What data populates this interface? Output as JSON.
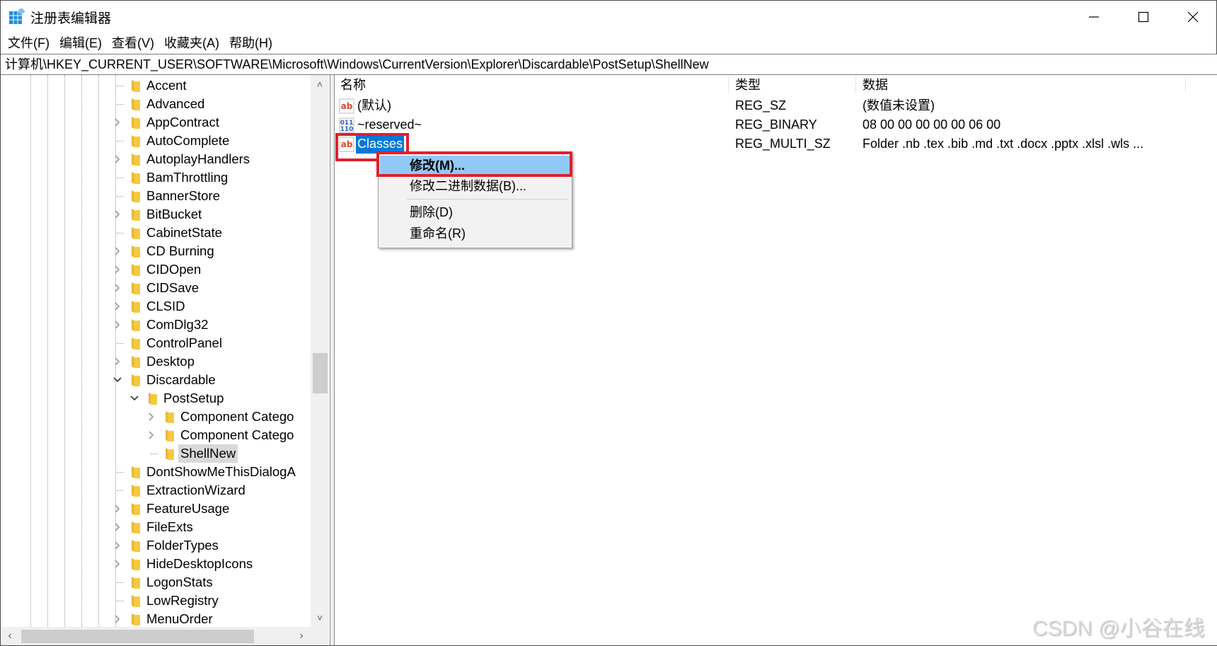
{
  "window": {
    "title": "注册表编辑器",
    "app_icon": "regedit-icon",
    "controls": {
      "minimize": "minimize-icon",
      "maximize": "maximize-icon",
      "close": "close-icon"
    }
  },
  "menu": [
    {
      "label": "文件(F)"
    },
    {
      "label": "编辑(E)"
    },
    {
      "label": "查看(V)"
    },
    {
      "label": "收藏夹(A)"
    },
    {
      "label": "帮助(H)"
    }
  ],
  "address": {
    "path": "计算机\\HKEY_CURRENT_USER\\SOFTWARE\\Microsoft\\Windows\\CurrentVersion\\Explorer\\Discardable\\PostSetup\\ShellNew"
  },
  "tree": {
    "items": [
      {
        "label": "Accent",
        "depth": 0,
        "expander": "none"
      },
      {
        "label": "Advanced",
        "depth": 0,
        "expander": "none"
      },
      {
        "label": "AppContract",
        "depth": 0,
        "expander": "collapsed"
      },
      {
        "label": "AutoComplete",
        "depth": 0,
        "expander": "none"
      },
      {
        "label": "AutoplayHandlers",
        "depth": 0,
        "expander": "collapsed"
      },
      {
        "label": "BamThrottling",
        "depth": 0,
        "expander": "none"
      },
      {
        "label": "BannerStore",
        "depth": 0,
        "expander": "none"
      },
      {
        "label": "BitBucket",
        "depth": 0,
        "expander": "collapsed"
      },
      {
        "label": "CabinetState",
        "depth": 0,
        "expander": "none"
      },
      {
        "label": "CD Burning",
        "depth": 0,
        "expander": "collapsed"
      },
      {
        "label": "CIDOpen",
        "depth": 0,
        "expander": "collapsed"
      },
      {
        "label": "CIDSave",
        "depth": 0,
        "expander": "collapsed"
      },
      {
        "label": "CLSID",
        "depth": 0,
        "expander": "collapsed"
      },
      {
        "label": "ComDlg32",
        "depth": 0,
        "expander": "collapsed"
      },
      {
        "label": "ControlPanel",
        "depth": 0,
        "expander": "none"
      },
      {
        "label": "Desktop",
        "depth": 0,
        "expander": "collapsed"
      },
      {
        "label": "Discardable",
        "depth": 0,
        "expander": "expanded"
      },
      {
        "label": "PostSetup",
        "depth": 1,
        "expander": "expanded"
      },
      {
        "label": "Component Catego",
        "depth": 2,
        "expander": "collapsed"
      },
      {
        "label": "Component Catego",
        "depth": 2,
        "expander": "collapsed"
      },
      {
        "label": "ShellNew",
        "depth": 2,
        "expander": "none",
        "selected": true
      },
      {
        "label": "DontShowMeThisDialogA",
        "depth": 0,
        "expander": "none"
      },
      {
        "label": "ExtractionWizard",
        "depth": 0,
        "expander": "none"
      },
      {
        "label": "FeatureUsage",
        "depth": 0,
        "expander": "collapsed"
      },
      {
        "label": "FileExts",
        "depth": 0,
        "expander": "collapsed"
      },
      {
        "label": "FolderTypes",
        "depth": 0,
        "expander": "collapsed"
      },
      {
        "label": "HideDesktopIcons",
        "depth": 0,
        "expander": "collapsed"
      },
      {
        "label": "LogonStats",
        "depth": 0,
        "expander": "none"
      },
      {
        "label": "LowRegistry",
        "depth": 0,
        "expander": "none"
      },
      {
        "label": "MenuOrder",
        "depth": 0,
        "expander": "collapsed"
      }
    ]
  },
  "list": {
    "columns": {
      "name": "名称",
      "type": "类型",
      "data": "数据"
    },
    "rows": [
      {
        "icon": "string-value-icon",
        "name": "(默认)",
        "type": "REG_SZ",
        "data": "(数值未设置)"
      },
      {
        "icon": "binary-value-icon",
        "name": "~reserved~",
        "type": "REG_BINARY",
        "data": "08 00 00 00 00 00 06 00"
      },
      {
        "icon": "string-value-icon",
        "name": "Classes",
        "type": "REG_MULTI_SZ",
        "data": "Folder .nb .tex .bib .md .txt .docx .pptx .xlsl .wls ...",
        "selected": true
      }
    ]
  },
  "context_menu": {
    "items": [
      {
        "label": "修改(M)...",
        "active": true
      },
      {
        "label": "修改二进制数据(B)..."
      },
      {
        "label": "删除(D)"
      },
      {
        "label": "重命名(R)"
      }
    ]
  },
  "colors": {
    "selection": "#0078d7",
    "menu_highlight": "#91c9f7",
    "annotation_red": "#e0202e",
    "folder": "#f5c842"
  },
  "watermark": "CSDN @小谷在线"
}
